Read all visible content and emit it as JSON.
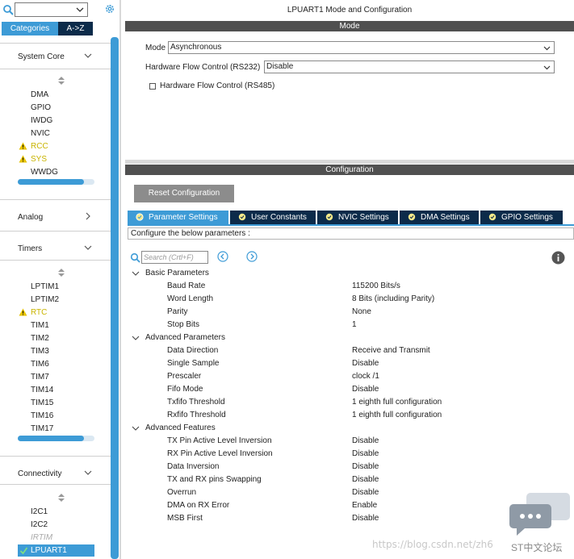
{
  "left_panel": {
    "search_placeholder": "",
    "tabs": {
      "categories": "Categories",
      "a_to_z": "A->Z"
    },
    "system_core": {
      "header": "System Core",
      "items": [
        {
          "label": "DMA",
          "warn": false
        },
        {
          "label": "GPIO",
          "warn": false
        },
        {
          "label": "IWDG",
          "warn": false
        },
        {
          "label": "NVIC",
          "warn": false
        },
        {
          "label": "RCC",
          "warn": true
        },
        {
          "label": "SYS",
          "warn": true
        },
        {
          "label": "WWDG",
          "warn": false
        }
      ]
    },
    "analog": {
      "header": "Analog"
    },
    "timers": {
      "header": "Timers",
      "items": [
        {
          "label": "LPTIM1",
          "warn": false
        },
        {
          "label": "LPTIM2",
          "warn": false
        },
        {
          "label": "RTC",
          "warn": true
        },
        {
          "label": "TIM1",
          "warn": false
        },
        {
          "label": "TIM2",
          "warn": false
        },
        {
          "label": "TIM3",
          "warn": false
        },
        {
          "label": "TIM6",
          "warn": false
        },
        {
          "label": "TIM7",
          "warn": false
        },
        {
          "label": "TIM14",
          "warn": false
        },
        {
          "label": "TIM15",
          "warn": false
        },
        {
          "label": "TIM16",
          "warn": false
        },
        {
          "label": "TIM17",
          "warn": false
        }
      ]
    },
    "connectivity": {
      "header": "Connectivity",
      "items": [
        {
          "label": "I2C1"
        },
        {
          "label": "I2C2"
        },
        {
          "label": "IRTIM",
          "disabled": true
        },
        {
          "label": "LPUART1",
          "selected": true
        }
      ]
    }
  },
  "main": {
    "title": "LPUART1 Mode and Configuration",
    "mode_section": "Mode",
    "mode_label": "Mode",
    "mode_value": "Asynchronous",
    "hw_flow_label": "Hardware Flow Control (RS232)",
    "hw_flow_value": "Disable",
    "rs485_label": "Hardware Flow Control (RS485)",
    "config_section": "Configuration",
    "reset_button": "Reset Configuration",
    "tabs": [
      {
        "label": "Parameter Settings",
        "active": true
      },
      {
        "label": "User Constants",
        "active": false
      },
      {
        "label": "NVIC Settings",
        "active": false
      },
      {
        "label": "DMA Settings",
        "active": false
      },
      {
        "label": "GPIO Settings",
        "active": false
      }
    ],
    "hint": "Configure the below parameters :",
    "search_placeholder": "Search (Crtl+F)",
    "groups": [
      {
        "name": "Basic Parameters",
        "params": [
          {
            "name": "Baud Rate",
            "value": "115200 Bits/s"
          },
          {
            "name": "Word Length",
            "value": "8 Bits (including Parity)"
          },
          {
            "name": "Parity",
            "value": "None"
          },
          {
            "name": "Stop Bits",
            "value": "1"
          }
        ]
      },
      {
        "name": "Advanced Parameters",
        "params": [
          {
            "name": "Data Direction",
            "value": "Receive and Transmit"
          },
          {
            "name": "Single Sample",
            "value": "Disable"
          },
          {
            "name": "Prescaler",
            "value": "clock /1"
          },
          {
            "name": "Fifo Mode",
            "value": "Disable"
          },
          {
            "name": "Txfifo Threshold",
            "value": "1 eighth full configuration"
          },
          {
            "name": "Rxfifo Threshold",
            "value": "1 eighth full configuration"
          }
        ]
      },
      {
        "name": "Advanced Features",
        "params": [
          {
            "name": "TX Pin Active Level Inversion",
            "value": "Disable"
          },
          {
            "name": "RX Pin Active Level Inversion",
            "value": "Disable"
          },
          {
            "name": "Data Inversion",
            "value": "Disable"
          },
          {
            "name": "TX and RX pins Swapping",
            "value": "Disable"
          },
          {
            "name": "Overrun",
            "value": "Disable"
          },
          {
            "name": "DMA on RX Error",
            "value": "Enable"
          },
          {
            "name": "MSB First",
            "value": "Disable"
          }
        ]
      }
    ]
  },
  "watermark": {
    "url": "https://blog.csdn.net/zh6",
    "brand": "ST中文论坛"
  },
  "colors": {
    "accent": "#3d9bd6",
    "dark_tab": "#0c2b4a",
    "section_bar": "#505050",
    "warning": "#e6c200"
  }
}
